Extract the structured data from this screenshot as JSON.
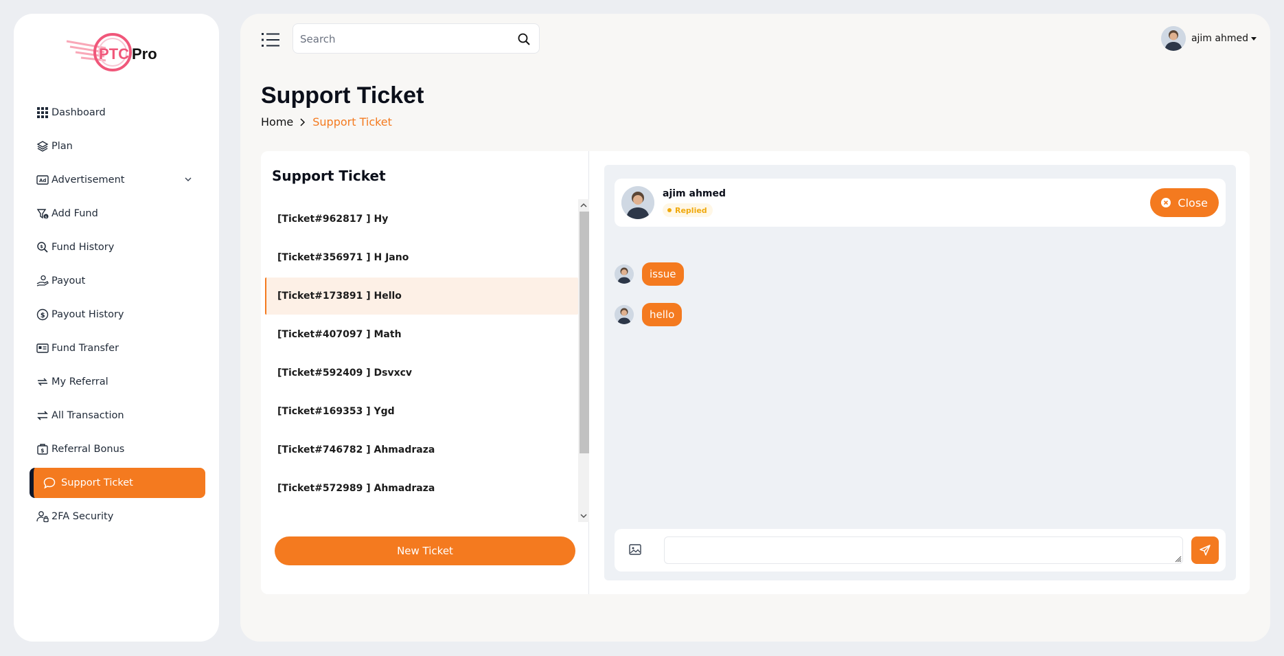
{
  "brand": {
    "logo_text_accent": "PTC",
    "logo_text": "Pro"
  },
  "sidebar": {
    "items": [
      {
        "label": "Dashboard",
        "icon": "grid-icon"
      },
      {
        "label": "Plan",
        "icon": "layers-icon"
      },
      {
        "label": "Advertisement",
        "icon": "ad-icon",
        "has_submenu": true
      },
      {
        "label": "Add Fund",
        "icon": "add-fund-icon"
      },
      {
        "label": "Fund History",
        "icon": "fund-history-icon"
      },
      {
        "label": "Payout",
        "icon": "payout-icon"
      },
      {
        "label": "Payout History",
        "icon": "dollar-circle-icon"
      },
      {
        "label": "Fund Transfer",
        "icon": "transfer-card-icon"
      },
      {
        "label": "My Referral",
        "icon": "referral-icon"
      },
      {
        "label": "All Transaction",
        "icon": "swap-icon"
      },
      {
        "label": "Referral Bonus",
        "icon": "bonus-icon"
      },
      {
        "label": "Support Ticket",
        "icon": "chat-icon",
        "active": true
      },
      {
        "label": "2FA Security",
        "icon": "user-lock-icon"
      }
    ]
  },
  "header": {
    "search": {
      "placeholder": "Search"
    },
    "user": {
      "name": "ajim ahmed"
    }
  },
  "page": {
    "title": "Support Ticket",
    "breadcrumb": {
      "home": "Home",
      "current": "Support Ticket"
    }
  },
  "tickets": {
    "title": "Support Ticket",
    "items": [
      {
        "label": "[Ticket#962817 ] Hy"
      },
      {
        "label": "[Ticket#356971 ] H Jano"
      },
      {
        "label": "[Ticket#173891 ] Hello",
        "active": true
      },
      {
        "label": "[Ticket#407097 ] Math"
      },
      {
        "label": "[Ticket#592409 ] Dsvxcv"
      },
      {
        "label": "[Ticket#169353 ] Ygd"
      },
      {
        "label": "[Ticket#746782 ] Ahmadraza"
      },
      {
        "label": "[Ticket#572989 ] Ahmadraza"
      }
    ],
    "new_ticket_label": "New Ticket"
  },
  "chat": {
    "user_name": "ajim ahmed",
    "status": "Replied",
    "close_label": "Close",
    "messages": [
      {
        "text": "issue"
      },
      {
        "text": "hello"
      }
    ],
    "composer": {
      "placeholder": ""
    }
  },
  "colors": {
    "accent": "#f47a1f",
    "status_replied": "#f0a90c",
    "dark": "#0f172a"
  }
}
